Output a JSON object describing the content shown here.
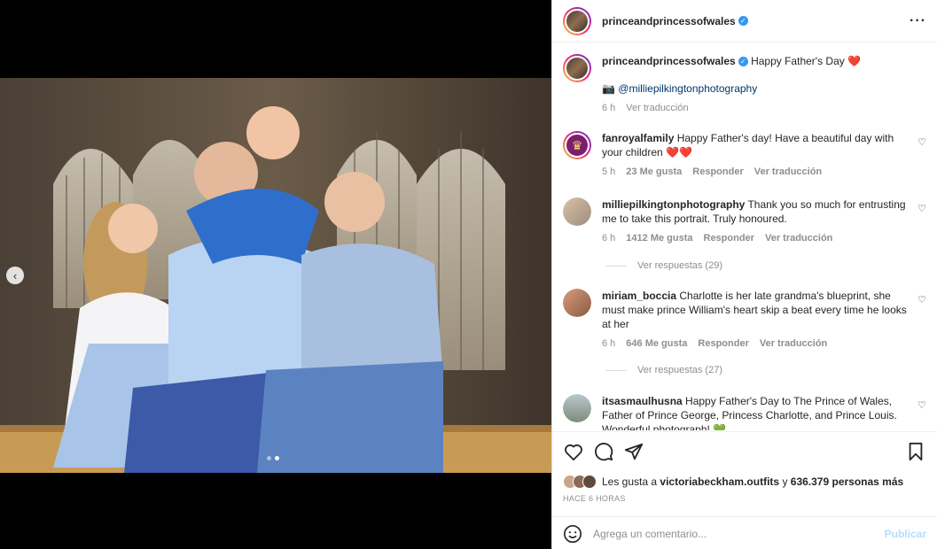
{
  "post": {
    "author": "princeandprincessofwales",
    "more_icon": "more-horizontal-icon"
  },
  "caption": {
    "username": "princeandprincessofwales",
    "text": "Happy Father's Day",
    "heart": "❤️",
    "credit_icon": "📷",
    "credit": "@milliepilkingtonphotography",
    "age": "6 h",
    "translate": "Ver traducción"
  },
  "comments": [
    {
      "username": "fanroyalfamily",
      "text": "Happy Father's day! Have a beautiful day with your children",
      "emoji": "❤️❤️",
      "age": "5 h",
      "likes": "23 Me gusta",
      "reply": "Responder",
      "translate": "Ver traducción"
    },
    {
      "username": "milliepilkingtonphotography",
      "text": "Thank you so much for entrusting me to take this portrait. Truly honoured.",
      "age": "6 h",
      "likes": "1412 Me gusta",
      "reply": "Responder",
      "translate": "Ver traducción",
      "replies": "Ver respuestas (29)"
    },
    {
      "username": "miriam_boccia",
      "text": "Charlotte is her late grandma's blueprint, she must make prince William's heart skip a beat every time he looks at her",
      "age": "6 h",
      "likes": "646 Me gusta",
      "reply": "Responder",
      "translate": "Ver traducción",
      "replies": "Ver respuestas (27)"
    },
    {
      "username": "itsasmaulhusna",
      "text": "Happy Father's Day to The Prince of Wales, Father of Prince George, Princess Charlotte, and Prince Louis. Wonderful photograph!",
      "emoji": "💚"
    }
  ],
  "likes": {
    "prefix": "Les gusta a",
    "user": "victoriabeckham.outfits",
    "joiner": "y",
    "others": "636.379 personas más"
  },
  "timestamp": "HACE 6 HORAS",
  "composer": {
    "placeholder": "Agrega un comentario...",
    "publish": "Publicar"
  },
  "carousel": {
    "prev_icon": "chevron-left-icon",
    "slides": 2,
    "active": 2
  },
  "colors": {
    "verified": "#3897f0",
    "heart": "#ed4956",
    "publish_disabled": "#b2dffc",
    "link": "#00376b"
  }
}
